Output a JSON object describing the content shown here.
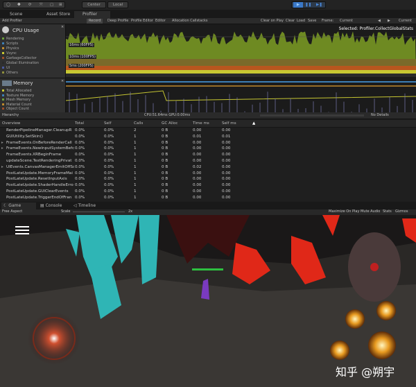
{
  "toolbar": {
    "pivot": "Center",
    "space": "Local"
  },
  "tabs": {
    "scene": "Scene",
    "asset_store": "Asset Store",
    "profiler": "Profiler"
  },
  "profiler_toolbar": {
    "add_profiler": "Add Profiler",
    "record": "Record",
    "deep_profile": "Deep Profile",
    "profile_editor": "Profile Editor",
    "editor": "Editor",
    "allocation_callstacks": "Allocation Callstacks",
    "clear_on_play": "Clear on Play",
    "clear": "Clear",
    "load": "Load",
    "save": "Save",
    "frame": "Frame:",
    "frame_value": "Current",
    "current": "Current"
  },
  "cpu": {
    "title": "CPU Usage",
    "selected": "Selected: Profiler.CollectGlobalStats",
    "items": [
      {
        "label": "Rendering",
        "color": "#6b9e3a"
      },
      {
        "label": "Scripts",
        "color": "#3d7fb5"
      },
      {
        "label": "Physics",
        "color": "#c08a2c"
      },
      {
        "label": "Vsync",
        "color": "#c8c832"
      },
      {
        "label": "GarbageCollector",
        "color": "#9c4e2a"
      },
      {
        "label": "Global Illumination",
        "color": "#2a2a2a"
      },
      {
        "label": "UI",
        "color": "#4a5aa0"
      },
      {
        "label": "Others",
        "color": "#8e8e3c"
      }
    ],
    "markers": [
      "16ms (60FPS)",
      "10ms (100FPS)",
      "5ms (200FPS)"
    ]
  },
  "memory": {
    "title": "Memory",
    "items": [
      {
        "label": "Total Allocated",
        "color": "#c8c832"
      },
      {
        "label": "Texture Memory",
        "color": "#3d7fb5"
      },
      {
        "label": "Mesh Memory",
        "color": "#6b9e3a"
      },
      {
        "label": "Material Count",
        "color": "#c08a2c"
      },
      {
        "label": "Object Count",
        "color": "#9c4e2a"
      }
    ]
  },
  "hierarchy": {
    "mode": "Hierarchy",
    "cpu_gpu": "CPU:51.64ms   GPU:0.00ms",
    "details": "No Details"
  },
  "table": {
    "headers": [
      "Overview",
      "Total",
      "Self",
      "Calls",
      "GC Alloc",
      "Time ms",
      "Self ms"
    ],
    "rows": [
      [
        "RenderPipelineManager.CleanupR",
        "0.0%",
        "0.0%",
        "2",
        "0 B",
        "0.00",
        "0.00",
        false
      ],
      [
        "GUIUtility.SetSkin()",
        "0.0%",
        "0.0%",
        "1",
        "0 B",
        "0.01",
        "0.01",
        false
      ],
      [
        "FrameEvents.OnBeforeRenderCall",
        "0.0%",
        "0.0%",
        "1",
        "0 B",
        "0.00",
        "0.00",
        true
      ],
      [
        "FrameEvents.NewInputSystemBefc",
        "0.0%",
        "0.0%",
        "1",
        "0 B",
        "0.00",
        "0.00",
        true
      ],
      [
        "FrameEvents.XRBeginFrame",
        "0.0%",
        "0.0%",
        "1",
        "0 B",
        "0.00",
        "0.00",
        false
      ],
      [
        "updateScene.TextRenderingPrivat",
        "0.0%",
        "0.0%",
        "1",
        "0 B",
        "0.00",
        "0.00",
        false
      ],
      [
        "UIEvents.CanvasManagerEmitOffSc",
        "0.0%",
        "0.0%",
        "1",
        "0 B",
        "0.02",
        "0.00",
        true
      ],
      [
        "PostLateUpdate.MemoryFrameMai",
        "0.0%",
        "0.0%",
        "1",
        "0 B",
        "0.00",
        "0.00",
        false
      ],
      [
        "PostLateUpdate.ResetInputAxis",
        "0.0%",
        "0.0%",
        "1",
        "0 B",
        "0.00",
        "0.00",
        false
      ],
      [
        "PostLateUpdate.ShaderHandleErro",
        "0.0%",
        "0.0%",
        "1",
        "0 B",
        "0.00",
        "0.00",
        false
      ],
      [
        "PostLateUpdate.GUIClearEvents",
        "0.0%",
        "0.0%",
        "1",
        "0 B",
        "0.00",
        "0.00",
        false
      ],
      [
        "PostLateUpdate.TriggerEndOfFran",
        "0.0%",
        "0.0%",
        "1",
        "0 B",
        "0.00",
        "0.00",
        false
      ]
    ]
  },
  "game_tabs": {
    "game": "Game",
    "console": "Console",
    "timeline": "Timeline"
  },
  "game_toolbar": {
    "aspect": "Free Aspect",
    "scale": "Scale",
    "scale_value": "2x",
    "maximize": "Maximize On Play",
    "mute": "Mute Audio",
    "stats": "Stats",
    "gizmos": "Gizmos"
  },
  "watermark": "知乎 @朔宇"
}
